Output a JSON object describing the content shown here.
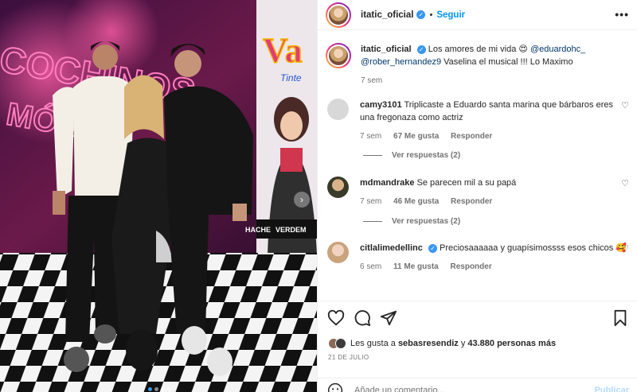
{
  "photo": {
    "alt_icons": [
      "chevron-right-icon"
    ],
    "dots_count": 4,
    "active_dot": 0
  },
  "header": {
    "username": "itatic_oficial",
    "separator": "•",
    "follow_label": "Seguir",
    "more_label": "•••"
  },
  "caption": {
    "username": "itatic_oficial",
    "text_1": "Los amores de mi vida 😍",
    "mention_1": "@eduardohc_",
    "mention_2": "@rober_hernandez9",
    "text_2": "Vaselina el musical !!! Lo Maximo",
    "time": "7 sem"
  },
  "comments": [
    {
      "username": "camy3101",
      "text": "Triplicaste a Eduardo santa marina que bárbaros eres una fregonaza como actriz",
      "time": "7 sem",
      "likes": "67 Me gusta",
      "reply": "Responder",
      "replies": "Ver respuestas (2)"
    },
    {
      "username": "mdmandrake",
      "text": "Se parecen mil a su papá",
      "time": "7 sem",
      "likes": "46 Me gusta",
      "reply": "Responder",
      "replies": "Ver respuestas (2)"
    },
    {
      "username": "citlalimedellinc",
      "text": "Preciosaaaaaa y guapísimossss esos chicos 🥰",
      "time": "6 sem",
      "likes": "11 Me gusta",
      "reply": "Responder"
    }
  ],
  "likes": {
    "prefix": "Les gusta a",
    "user": "sebasresendiz",
    "middle": "y",
    "others": "43.880 personas más"
  },
  "date": "21 DE JULIO",
  "add_comment": {
    "placeholder": "Añade un comentario...",
    "publish": "Publicar"
  },
  "colors": {
    "accent": "#0095f6",
    "verified": "#3897f0",
    "muted": "#737373",
    "publish_disabled": "#b3dbff"
  }
}
